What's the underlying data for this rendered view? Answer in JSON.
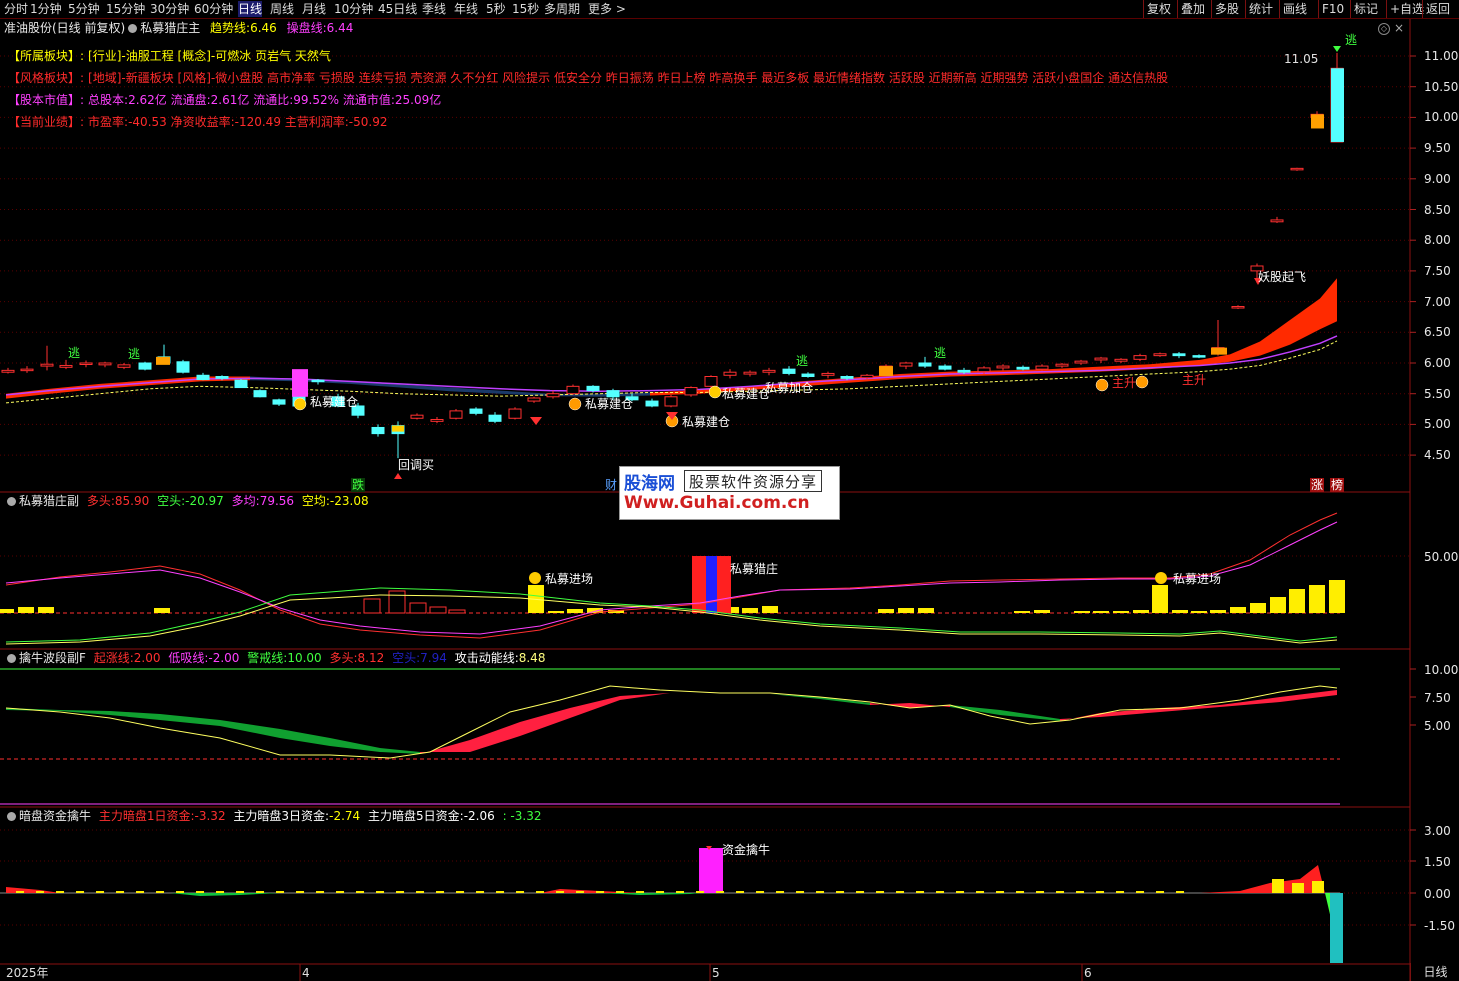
{
  "toolbar": {
    "periods": [
      "分时",
      "1分钟",
      "5分钟",
      "15分钟",
      "30分钟",
      "60分钟",
      "日线",
      "周线",
      "月线",
      "10分钟",
      "45日线",
      "季线",
      "年线",
      "5秒",
      "15秒",
      "多周期",
      "更多 >"
    ],
    "active_period": "日线",
    "right_buttons": [
      "复权",
      "叠加",
      "多股",
      "统计",
      "画线",
      "F10",
      "标记",
      "+自选",
      "返回"
    ]
  },
  "main_panel": {
    "stock_title": "准油股份(日线 前复权)",
    "indicator_name": "私募猎庄主",
    "trend_label": "趋势线:",
    "trend_value": "6.46",
    "control_label": "操盘线:",
    "control_value": "6.44",
    "info_lines": [
      {
        "tag": "【所属板块】:",
        "text": "[行业]-油服工程 [概念]-可燃冰 页岩气 天然气"
      },
      {
        "tag": "【风格板块】:",
        "text": "[地域]-新疆板块 [风格]-微小盘股 高市净率 亏损股 连续亏损 壳资源 久不分红 风险提示 低安全分 昨日振荡 昨日上榜 昨高换手 最近多板 最近情绪指数 活跃股 近期新高 近期强势 活跃小盘国企 通达信热股"
      },
      {
        "tag": "【股本市值】:",
        "text": "总股本:2.62亿 流通盘:2.61亿 流通比:99.52% 流通市值:25.09亿"
      },
      {
        "tag": "【当前业绩】:",
        "text": "市盈率:-40.53 净资收益率:-120.49 主营利润率:-50.92"
      }
    ],
    "y_ticks": [
      "11.00",
      "10.50",
      "10.00",
      "9.50",
      "9.00",
      "8.50",
      "8.00",
      "7.50",
      "7.00",
      "6.50",
      "6.00",
      "5.50",
      "5.00",
      "4.50"
    ],
    "peak_price": "11.05",
    "annotations": {
      "sm_jc1": "私募建仓",
      "sm_jc2": "私募建仓",
      "sm_jc3": "私募建仓",
      "sm_jc_mid": "私募建仓",
      "sm_jc_add": "私募加仓",
      "main_up": "主升",
      "main_up2": "主升",
      "yao_fly": "妖股起飞",
      "huitiao": "回调买",
      "escape": "逃",
      "die": "跌",
      "zhang": "涨",
      "bang": "榜",
      "cai": "财"
    },
    "colors": {
      "up": "#ff3030",
      "down": "#54ffff",
      "ribbon_up": "#ff2a00",
      "ribbon_down": "#1a3a6a"
    }
  },
  "panel2": {
    "name": "私募猎庄副",
    "duo_label": "多头:",
    "duo_value": "85.90",
    "kong_label": "空头:",
    "kong_value": "-20.97",
    "duojun_label": "多均:",
    "duojun_value": "79.56",
    "kongjun_label": "空均:",
    "kongjun_value": "-23.08",
    "y_tick": "50.00",
    "ann_enter1": "私募进场",
    "ann_hunt": "私募猎庄",
    "ann_enter2": "私募进场"
  },
  "panel3": {
    "name": "擒牛波段副F",
    "rise_label": "起涨线:",
    "rise_value": "2.00",
    "low_label": "低吸线:",
    "low_value": "-2.00",
    "warn_label": "警戒线:",
    "warn_value": "10.00",
    "duo_label": "多头:",
    "duo_value": "8.12",
    "kong_label": "空头:",
    "kong_value": "7.94",
    "atk_label": "攻击动能线:",
    "atk_value": "8.48",
    "y_ticks": [
      "10.00",
      "7.50",
      "5.00"
    ]
  },
  "panel4": {
    "name": "暗盘资金擒牛",
    "d1_label": "主力暗盘1日资金:",
    "d1_value": "-3.32",
    "d3_label": "主力暗盘3日资金:",
    "d3_value": "-2.74",
    "d5_label": "主力暗盘5日资金:",
    "d5_value": "-2.06",
    "extra_value": ": -3.32",
    "y_ticks": [
      "3.00",
      "1.50",
      "0.00",
      "-1.50"
    ],
    "ann": "资金擒牛"
  },
  "xaxis": {
    "labels": [
      "2025年",
      "4",
      "5",
      "6"
    ],
    "status": "日线"
  },
  "watermark": {
    "brand": "股海网",
    "slogan": "股票软件资源分享",
    "url": "Www.Guhai.com.cn"
  }
}
